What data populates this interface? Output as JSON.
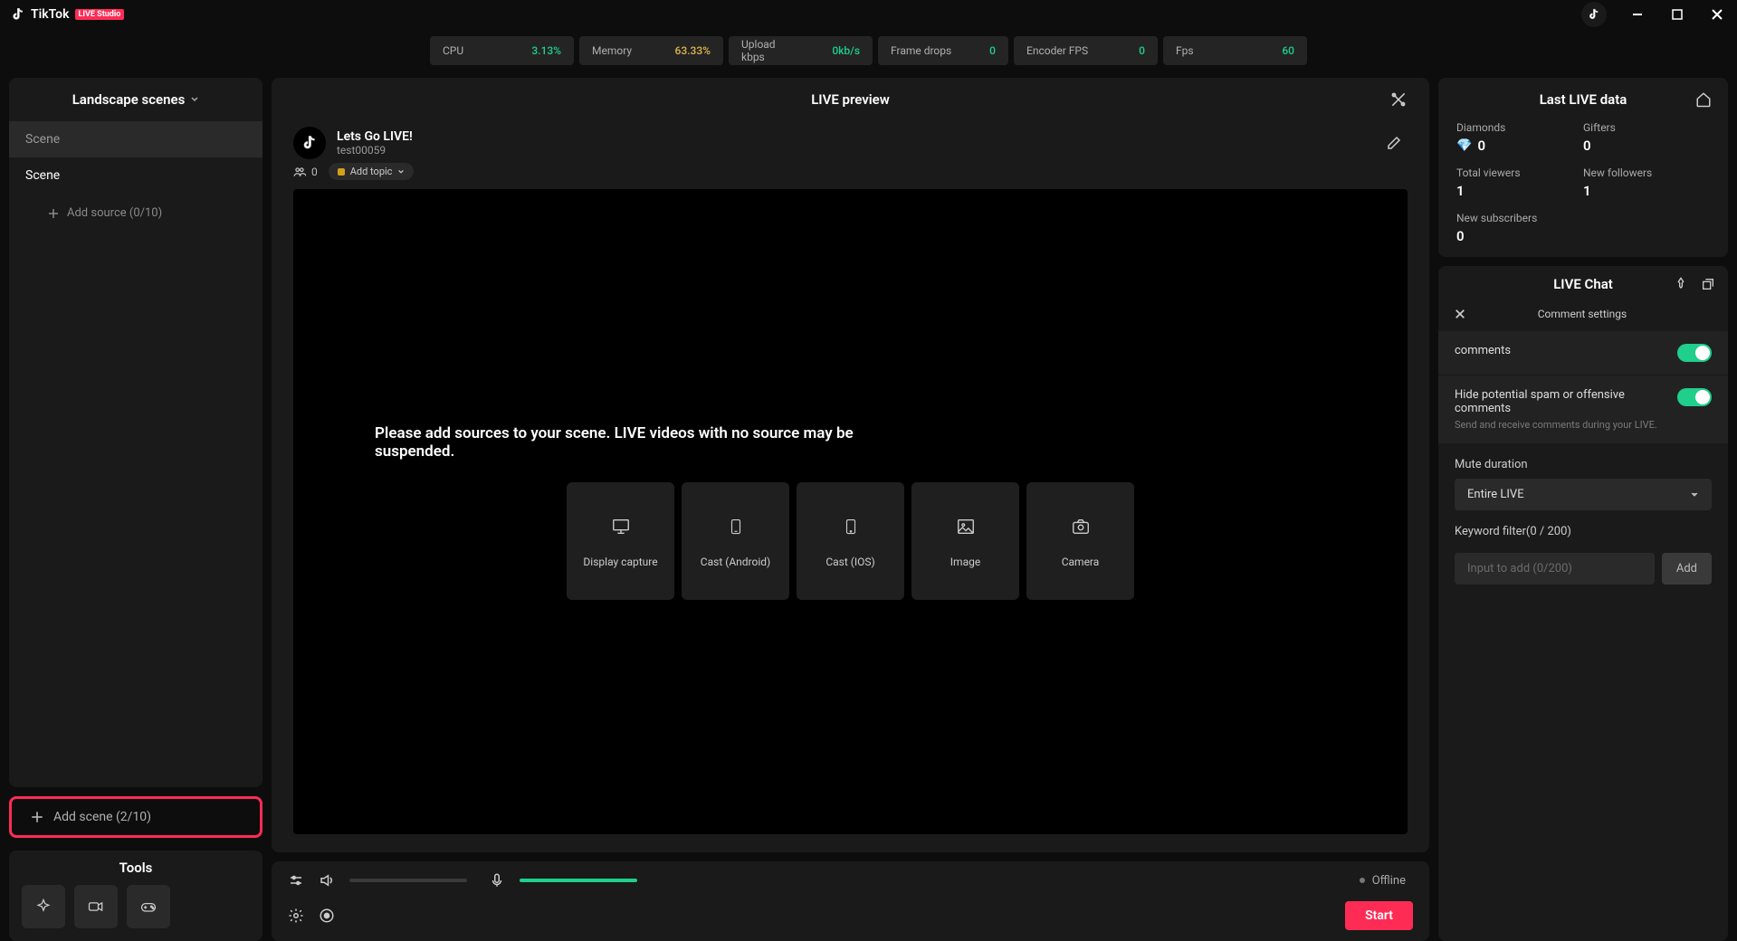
{
  "app": {
    "name": "TikTok",
    "badge": "LIVE Studio"
  },
  "stats": {
    "cpu": {
      "label": "CPU",
      "value": "3.13%",
      "color": "#1fcf8b"
    },
    "memory": {
      "label": "Memory",
      "value": "63.33%",
      "color": "#e0b84a"
    },
    "upload": {
      "label": "Upload kbps",
      "value": "0kb/s",
      "color": "#1fcf8b"
    },
    "drops": {
      "label": "Frame drops",
      "value": "0",
      "color": "#1fcf8b"
    },
    "encfps": {
      "label": "Encoder FPS",
      "value": "0",
      "color": "#1fcf8b"
    },
    "fps": {
      "label": "Fps",
      "value": "60",
      "color": "#1fcf8b"
    }
  },
  "sidebar": {
    "header": "Landscape scenes",
    "scenes": [
      "Scene",
      "Scene"
    ],
    "add_source": "Add source (0/10)",
    "add_scene": "Add scene (2/10)",
    "tools_title": "Tools"
  },
  "preview": {
    "title": "LIVE preview",
    "stream_title": "Lets Go LIVE!",
    "username": "test00059",
    "viewer_count": "0",
    "add_topic": "Add topic",
    "no_source_msg": "Please add sources to your scene. LIVE videos with no source may be suspended.",
    "sources": {
      "display": "Display capture",
      "android": "Cast (Android)",
      "ios": "Cast (IOS)",
      "image": "Image",
      "camera": "Camera"
    }
  },
  "bottombar": {
    "status": "Offline",
    "start": "Start"
  },
  "lastdata": {
    "title": "Last LIVE data",
    "diamonds": {
      "label": "Diamonds",
      "value": "0"
    },
    "gifters": {
      "label": "Gifters",
      "value": "0"
    },
    "viewers": {
      "label": "Total viewers",
      "value": "1"
    },
    "followers": {
      "label": "New followers",
      "value": "1"
    },
    "subs": {
      "label": "New subscribers",
      "value": "0"
    }
  },
  "chat": {
    "title": "LIVE Chat",
    "settings_title": "Comment settings",
    "comments_label": "comments",
    "hide_spam_label": "Hide potential spam or offensive comments",
    "hide_spam_help": "Send and receive comments during your LIVE.",
    "mute_label": "Mute duration",
    "mute_value": "Entire LIVE",
    "keyword_label": "Keyword filter(0 / 200)",
    "keyword_placeholder": "Input to add (0/200)",
    "keyword_add": "Add"
  }
}
